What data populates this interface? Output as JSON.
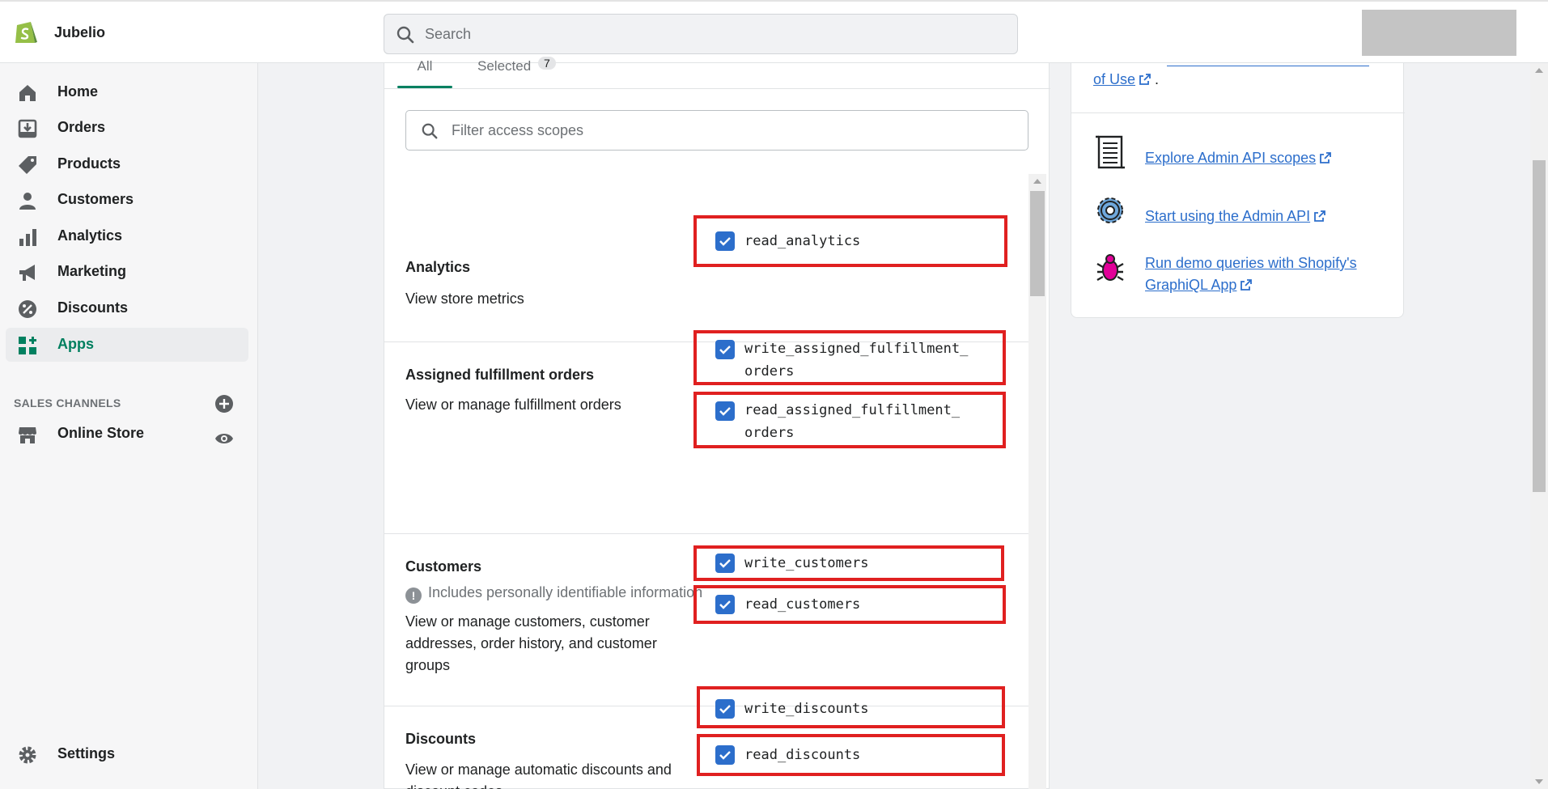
{
  "header": {
    "shop_name": "Jubelio",
    "search_placeholder": "Search"
  },
  "sidebar": {
    "items": [
      {
        "label": "Home",
        "icon": "home-icon"
      },
      {
        "label": "Orders",
        "icon": "orders-icon"
      },
      {
        "label": "Products",
        "icon": "tag-icon"
      },
      {
        "label": "Customers",
        "icon": "person-icon"
      },
      {
        "label": "Analytics",
        "icon": "bar-chart-icon"
      },
      {
        "label": "Marketing",
        "icon": "megaphone-icon"
      },
      {
        "label": "Discounts",
        "icon": "discount-icon"
      },
      {
        "label": "Apps",
        "icon": "apps-icon"
      }
    ],
    "active_item": "Apps",
    "sales_channels_title": "SALES CHANNELS",
    "online_store": "Online Store",
    "settings": "Settings"
  },
  "tabs": {
    "all": "All",
    "selected": "Selected",
    "selected_count": "7"
  },
  "filter_placeholder": "Filter access scopes",
  "sections": [
    {
      "title": "Analytics",
      "description": "View store metrics",
      "scopes": [
        "read_analytics"
      ]
    },
    {
      "title": "Assigned fulfillment orders",
      "description": "View or manage fulfillment orders",
      "scopes": [
        "write_assigned_fulfillment_ orders",
        "read_assigned_fulfillment_ orders"
      ]
    },
    {
      "title": "Customers",
      "warning": "Includes personally identifiable information",
      "description": "View or manage customers, customer addresses, order history, and customer groups",
      "scopes": [
        "write_customers",
        "read_customers"
      ]
    },
    {
      "title": "Discounts",
      "description": "View or manage automatic discounts and discount codes",
      "scopes": [
        "write_discounts",
        "read_discounts"
      ]
    }
  ],
  "right_panel": {
    "terms_text": "of Use",
    "terms_suffix": ".",
    "links": [
      {
        "label": "Explore Admin API scopes",
        "icon": "scroll-document-icon"
      },
      {
        "label": "Start using the Admin API",
        "icon": "gear-icon"
      },
      {
        "label": "Run demo queries with Shopify's GraphiQL App",
        "icon": "bug-icon"
      }
    ]
  },
  "colors": {
    "accent": "#008060",
    "link": "#2c6ecb",
    "checkbox": "#2c6ecb",
    "highlight": "#e02020"
  }
}
